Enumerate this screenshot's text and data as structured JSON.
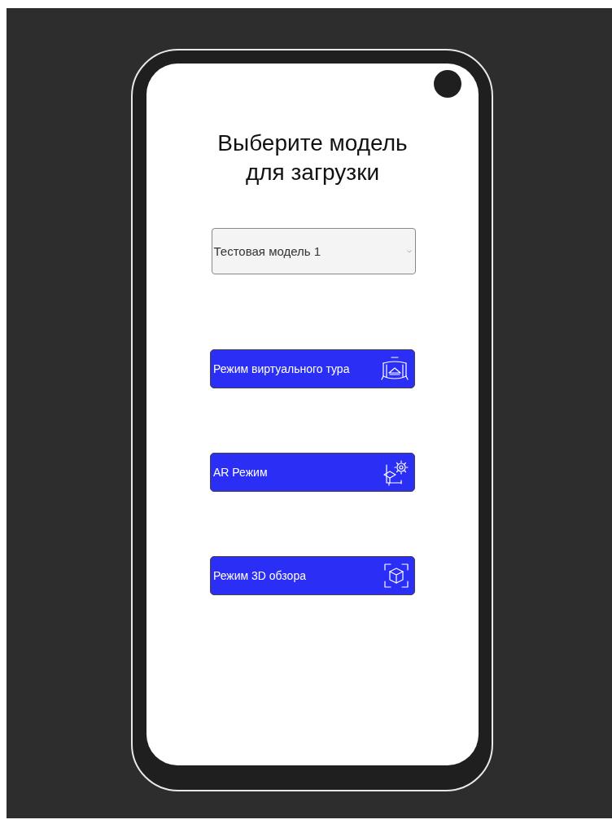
{
  "title": "Выберите модель для загрузки",
  "model_select": {
    "value": "Тестовая модель 1"
  },
  "buttons": [
    {
      "label": "Режим виртуального тура",
      "kind": "tour"
    },
    {
      "label": "AR Режим",
      "kind": "ar"
    },
    {
      "label": "Режим 3D обзора",
      "kind": "view3d"
    }
  ]
}
